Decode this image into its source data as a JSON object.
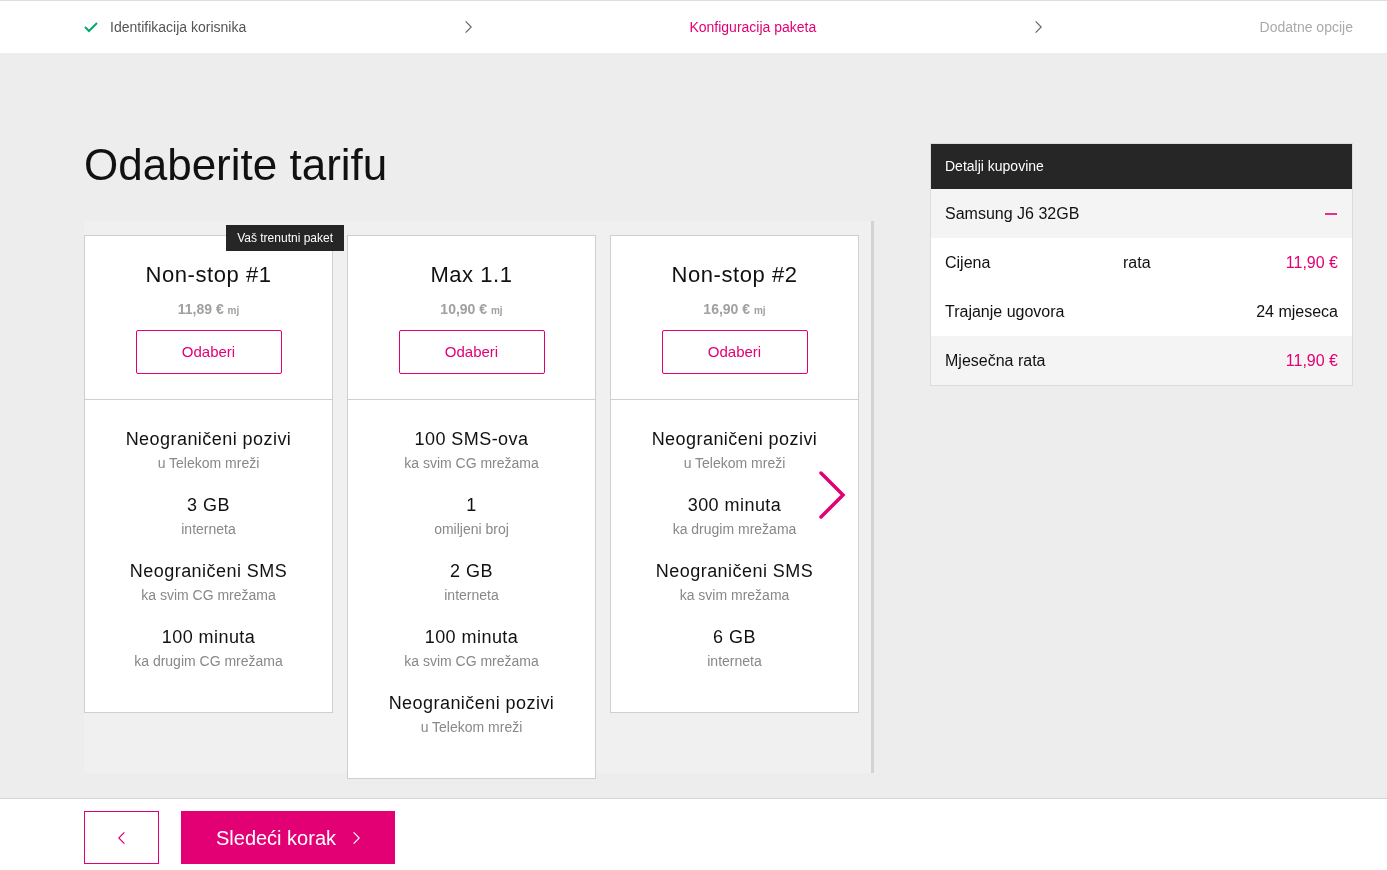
{
  "steps": [
    {
      "label": "Identifikacija korisnika",
      "done": true,
      "selected": false
    },
    {
      "label": "Konfiguracija paketa",
      "done": false,
      "selected": true
    },
    {
      "label": "Dodatne opcije",
      "done": false,
      "selected": false
    }
  ],
  "heading": "Odaberite tarifu",
  "plans": [
    {
      "name": "Non-stop #1",
      "price": "11,89 €",
      "unit": "mj",
      "button": "Odaberi",
      "badge": "Vaš trenutni paket",
      "features": [
        {
          "title": "Neograničeni pozivi",
          "sub": "u Telekom mreži"
        },
        {
          "title": "3 GB",
          "sub": "interneta"
        },
        {
          "title": "Neograničeni SMS",
          "sub": "ka svim CG mrežama"
        },
        {
          "title": "100 minuta",
          "sub": "ka drugim CG mrežama"
        }
      ]
    },
    {
      "name": "Max 1.1",
      "price": "10,90 €",
      "unit": "mj",
      "button": "Odaberi",
      "features": [
        {
          "title": "100 SMS-ova",
          "sub": "ka svim CG mrežama"
        },
        {
          "title": "1",
          "sub": "omiljeni broj"
        },
        {
          "title": "2 GB",
          "sub": "interneta"
        },
        {
          "title": "100 minuta",
          "sub": "ka svim CG mrežama"
        },
        {
          "title": "Neograničeni pozivi",
          "sub": "u Telekom mreži"
        }
      ]
    },
    {
      "name": "Non-stop #2",
      "price": "16,90 €",
      "unit": "mj",
      "button": "Odaberi",
      "features": [
        {
          "title": "Neograničeni pozivi",
          "sub": "u Telekom mreži"
        },
        {
          "title": "300 minuta",
          "sub": "ka drugim mrežama"
        },
        {
          "title": "Neograničeni SMS",
          "sub": "ka svim mrežama"
        },
        {
          "title": "6 GB",
          "sub": "interneta"
        }
      ]
    }
  ],
  "details": {
    "title": "Detalji kupovine",
    "rows": [
      {
        "kind": "item",
        "label": "Samsung J6 32GB",
        "expanded": true
      },
      {
        "kind": "detail",
        "label": "Cijena",
        "note": "rata",
        "value": "11,90 €",
        "highlight": true
      },
      {
        "kind": "detail",
        "label": "Trajanje ugovora",
        "value": "24 mjeseca",
        "highlight": false
      },
      {
        "kind": "total",
        "label": "Mjesečna rata",
        "value": "11,90 €",
        "highlight": true
      }
    ]
  },
  "next_button": "Sledeći korak"
}
